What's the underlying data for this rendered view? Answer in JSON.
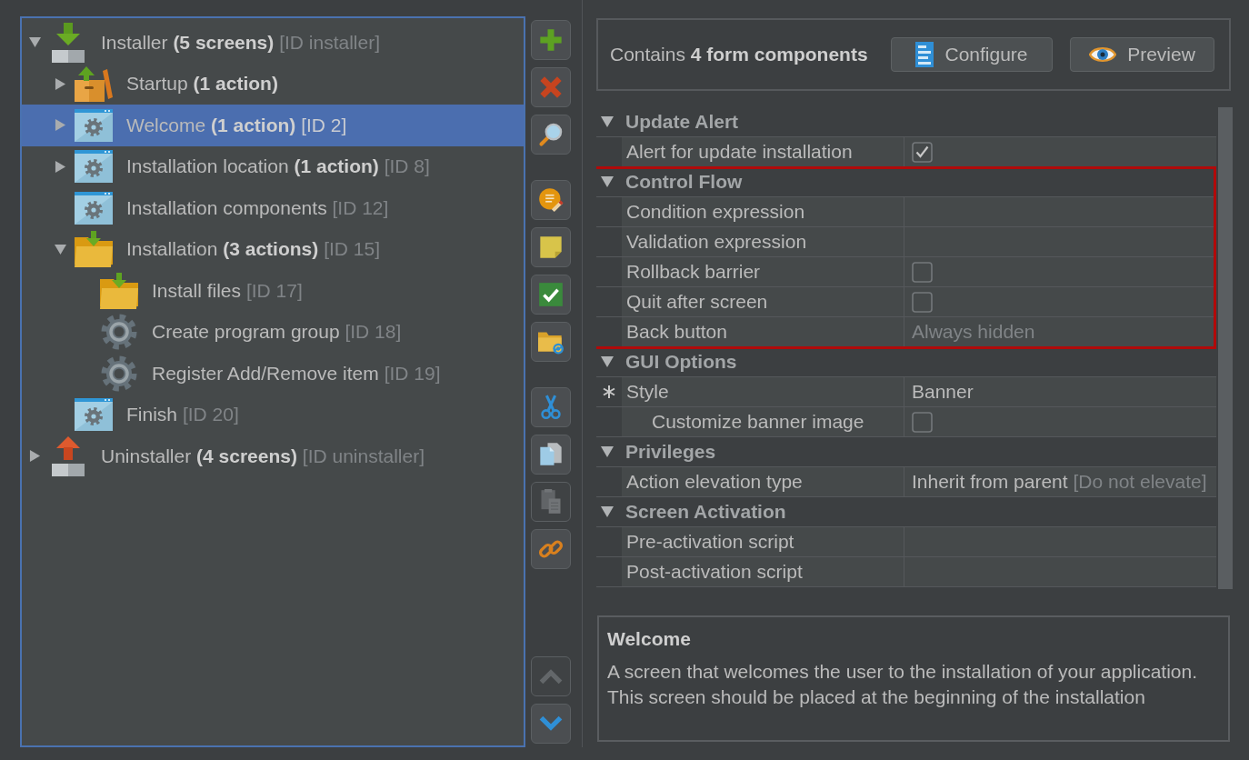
{
  "tree": {
    "items": [
      {
        "kind": "installer",
        "label": "Installer",
        "count": "(5 screens)",
        "id_label": "[ID installer]",
        "expanded": true,
        "selected": false,
        "children": [
          {
            "kind": "startup",
            "label": "Startup",
            "count": "(1 action)",
            "expanded": false,
            "selected": false
          },
          {
            "kind": "screen",
            "label": "Welcome",
            "count": "(1 action)",
            "id_label": "[ID 2]",
            "expanded": false,
            "selected": true
          },
          {
            "kind": "screen",
            "label": "Installation location",
            "count": "(1 action)",
            "id_label": "[ID 8]",
            "expanded": false,
            "selected": false
          },
          {
            "kind": "screen",
            "label": "Installation components",
            "id_label": "[ID 12]",
            "selected": false
          },
          {
            "kind": "folder",
            "label": "Installation",
            "count": "(3 actions)",
            "id_label": "[ID 15]",
            "expanded": true,
            "selected": false,
            "children": [
              {
                "kind": "folder",
                "label": "Install files",
                "id_label": "[ID 17]",
                "selected": false
              },
              {
                "kind": "gear",
                "label": "Create program group",
                "id_label": "[ID 18]",
                "selected": false
              },
              {
                "kind": "gear",
                "label": "Register Add/Remove item",
                "id_label": "[ID 19]",
                "selected": false
              }
            ]
          },
          {
            "kind": "screen",
            "label": "Finish",
            "id_label": "[ID 20]",
            "selected": false
          }
        ]
      },
      {
        "kind": "uninstaller",
        "label": "Uninstaller",
        "count": "(4 screens)",
        "id_label": "[ID uninstaller]",
        "expanded": false,
        "selected": false
      }
    ]
  },
  "toolbar": {
    "groups": [
      {
        "buttons": [
          {
            "kind": "add",
            "disabled": false
          },
          {
            "kind": "delete",
            "disabled": false
          },
          {
            "kind": "search",
            "disabled": false
          }
        ]
      },
      {
        "buttons": [
          {
            "kind": "comment",
            "disabled": false
          },
          {
            "kind": "note",
            "disabled": false
          },
          {
            "kind": "check",
            "disabled": false
          },
          {
            "kind": "folder",
            "disabled": false
          }
        ]
      },
      {
        "buttons": [
          {
            "kind": "cut",
            "disabled": false
          },
          {
            "kind": "copy",
            "disabled": false
          },
          {
            "kind": "paste",
            "disabled": true
          },
          {
            "kind": "link",
            "disabled": false
          }
        ]
      }
    ],
    "move_buttons": [
      {
        "kind": "up",
        "disabled": true
      },
      {
        "kind": "down",
        "disabled": false
      }
    ]
  },
  "summary": {
    "text": "Contains **4 form components**",
    "buttons": [
      {
        "kind": "configure",
        "label": "Configure"
      },
      {
        "kind": "preview",
        "label": "Preview"
      }
    ]
  },
  "properties": {
    "groups": [
      {
        "title": "Update Alert",
        "expanded": true,
        "highlighted": false,
        "rows": [
          {
            "name": "Alert for update installation",
            "kind": "checkbox",
            "checked": true,
            "modified": false
          }
        ]
      },
      {
        "title": "Control Flow",
        "expanded": true,
        "highlighted": true,
        "rows": [
          {
            "name": "Condition expression",
            "kind": "text",
            "modified": false
          },
          {
            "name": "Validation expression",
            "kind": "text",
            "modified": false
          },
          {
            "name": "Rollback barrier",
            "kind": "checkbox",
            "checked": false,
            "modified": false
          },
          {
            "name": "Quit after screen",
            "kind": "checkbox",
            "checked": false,
            "modified": false
          },
          {
            "name": "Back button",
            "kind": "default",
            "value": "Always hidden",
            "modified": false
          }
        ]
      },
      {
        "title": "GUI Options",
        "expanded": true,
        "highlighted": false,
        "rows": [
          {
            "name": "Style",
            "kind": "text",
            "value": "Banner",
            "modified": true,
            "children": [
              {
                "name": "Customize banner image",
                "kind": "checkbox",
                "checked": false,
                "modified": false
              }
            ]
          }
        ]
      },
      {
        "title": "Privileges",
        "expanded": true,
        "highlighted": false,
        "rows": [
          {
            "name": "Action elevation type",
            "kind": "text",
            "value": "Inherit from parent",
            "note": "[Do not elevate]",
            "modified": false
          }
        ]
      },
      {
        "title": "Screen Activation",
        "expanded": true,
        "highlighted": false,
        "rows": [
          {
            "name": "Pre-activation script",
            "kind": "text",
            "modified": false
          },
          {
            "name": "Post-activation script",
            "kind": "text",
            "modified": false
          }
        ]
      }
    ]
  },
  "description": {
    "title": "Welcome",
    "text": "A screen that welcomes the user to the installation of your application. This screen should be placed at the beginning of the installation"
  }
}
